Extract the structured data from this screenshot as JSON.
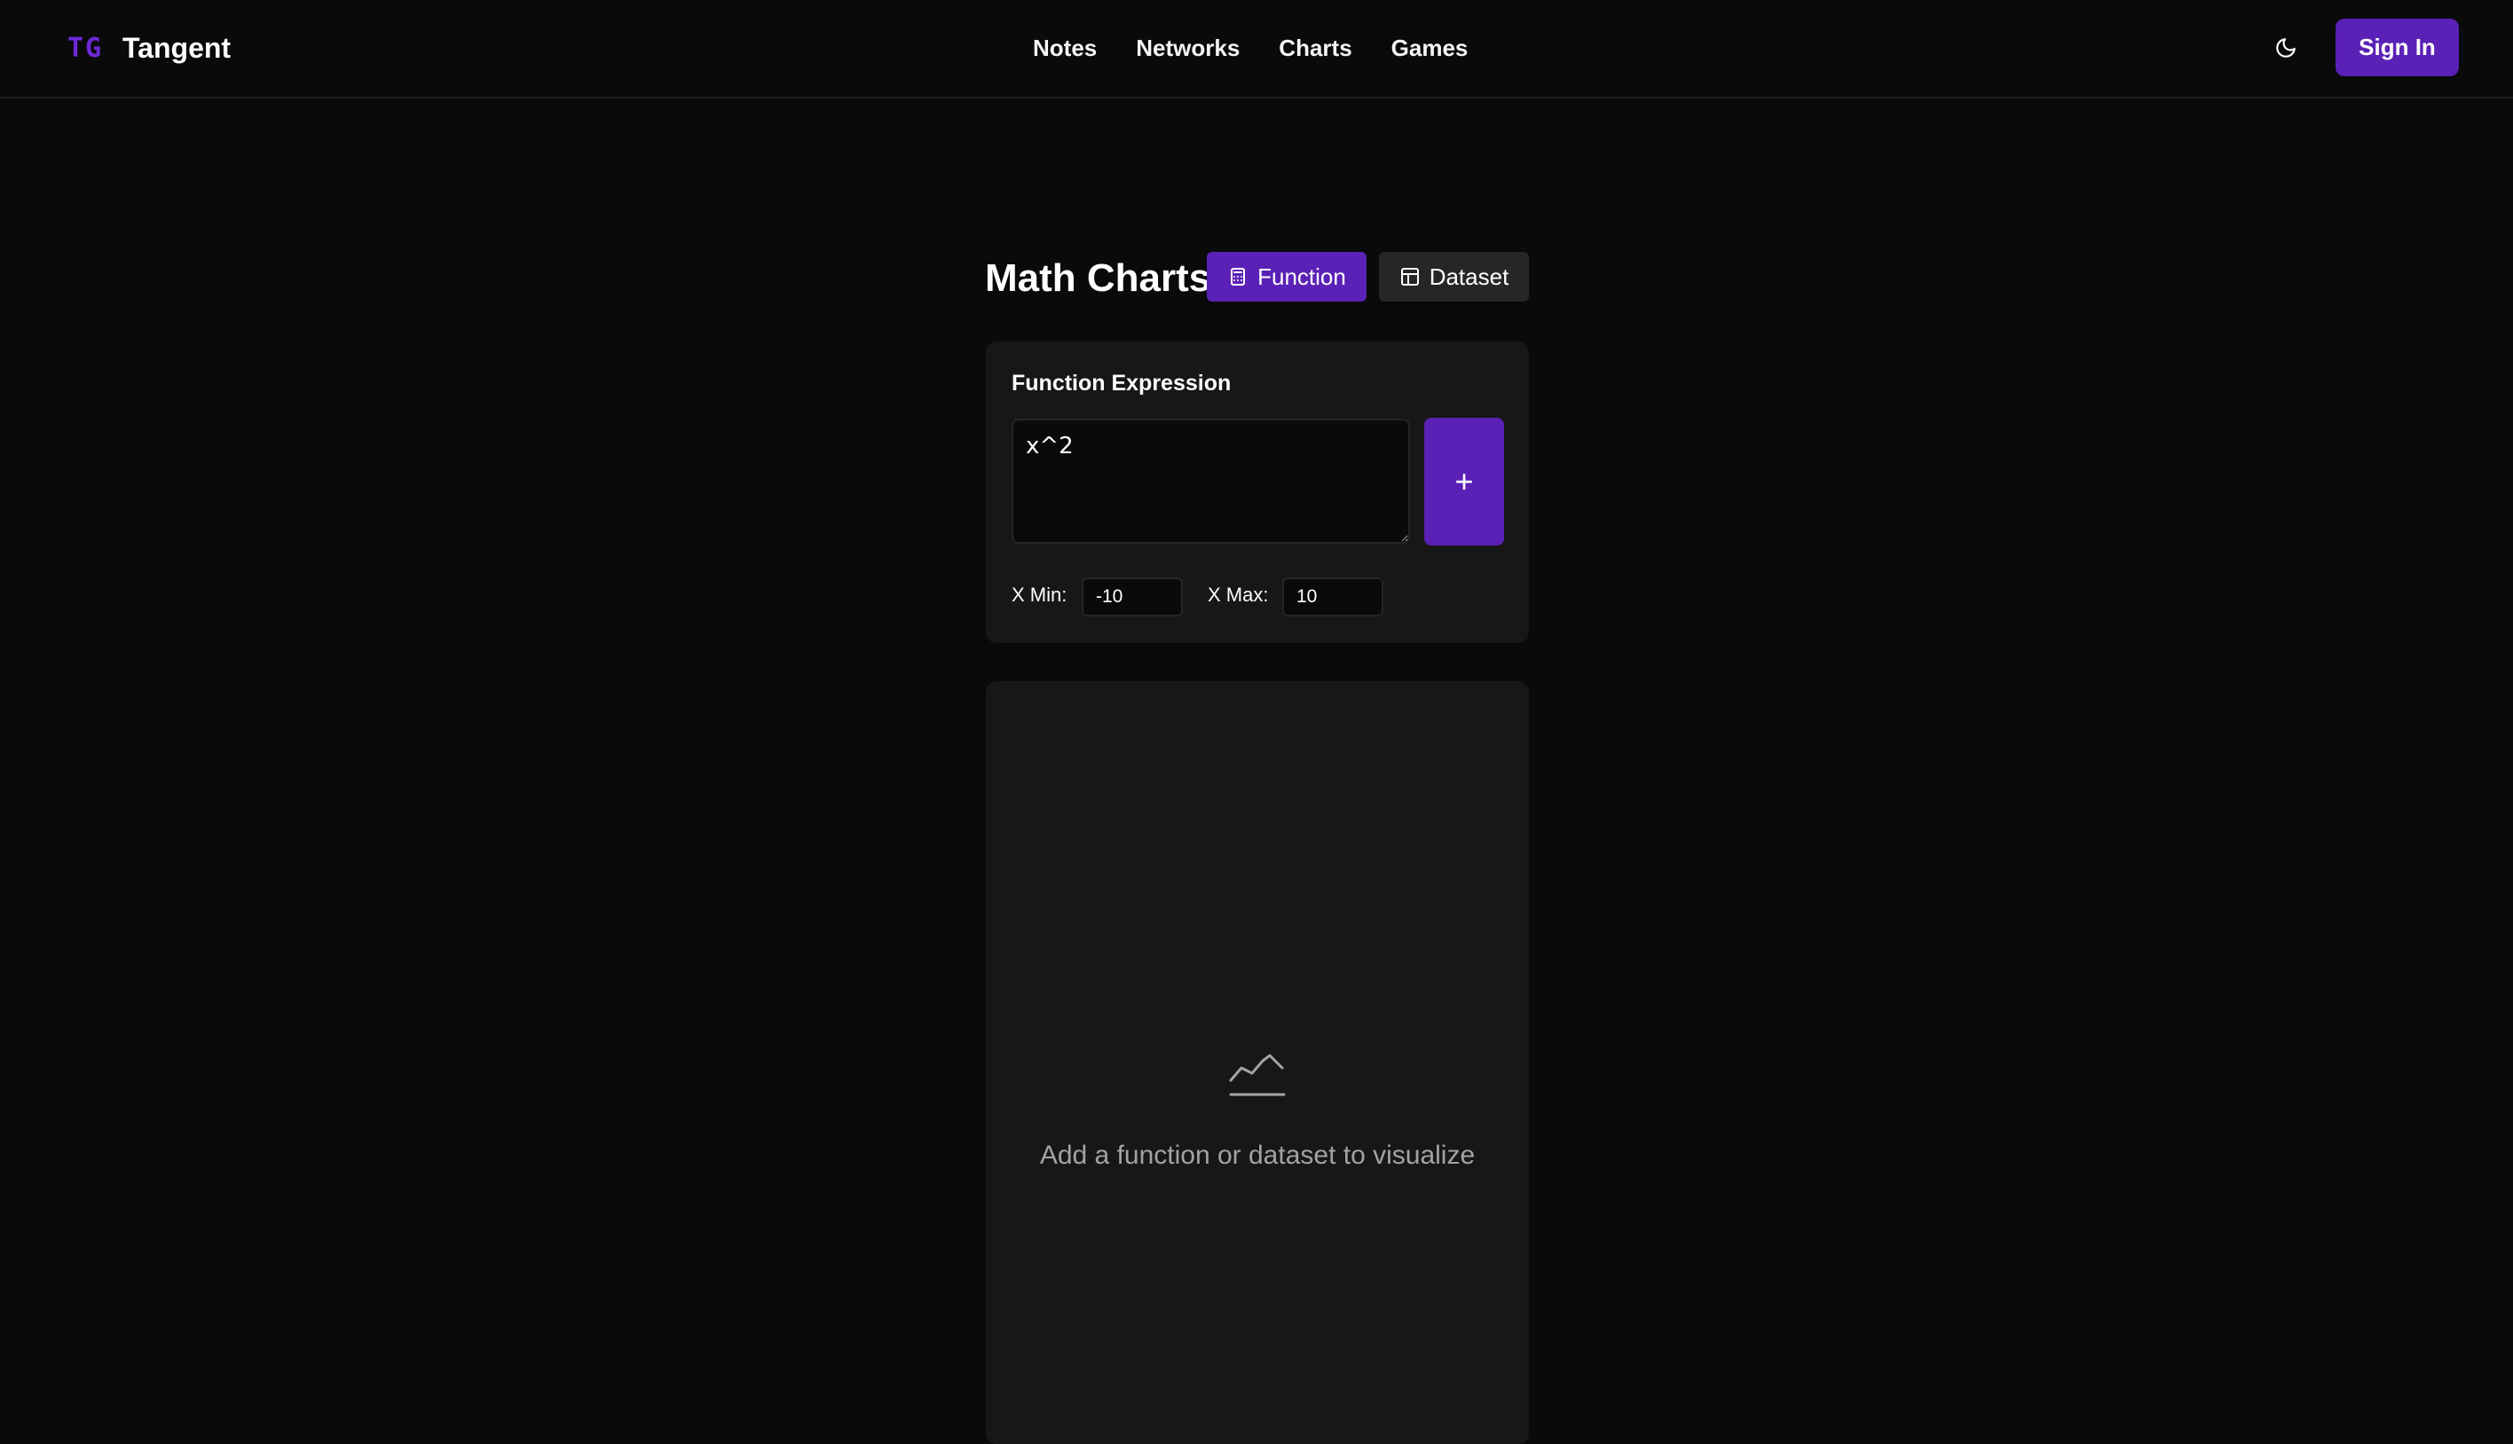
{
  "brand": {
    "logo": "TG",
    "name": "Tangent",
    "accent": "#5b21b6"
  },
  "nav": {
    "items": [
      "Notes",
      "Networks",
      "Charts",
      "Games"
    ]
  },
  "header": {
    "sign_in": "Sign In",
    "theme_icon": "moon-icon"
  },
  "page": {
    "title": "Math Charts"
  },
  "tabs": {
    "function": {
      "label": "Function",
      "icon": "calculator-icon",
      "active": true
    },
    "dataset": {
      "label": "Dataset",
      "icon": "table-icon",
      "active": false
    }
  },
  "function_form": {
    "label": "Function Expression",
    "expression": "x^2",
    "add_icon": "plus-icon",
    "add_glyph": "+",
    "x_min_label": "X Min:",
    "x_min": "-10",
    "x_max_label": "X Max:",
    "x_max": "10"
  },
  "chart": {
    "empty_icon": "line-chart-icon",
    "empty_text": "Add a function or dataset to visualize"
  }
}
